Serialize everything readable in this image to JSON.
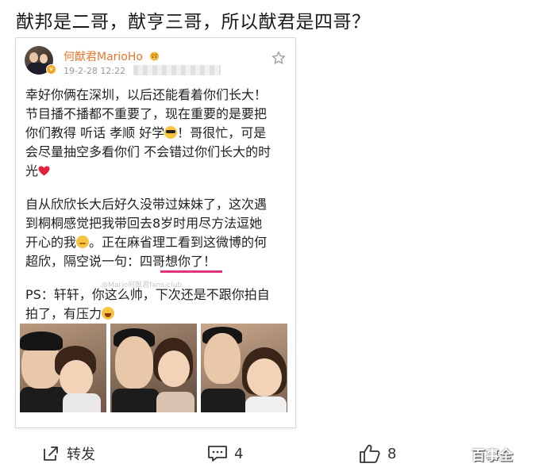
{
  "headline": "猷邦是二哥，猷亨三哥，所以猷君是四哥？",
  "post": {
    "author": "何猷君MarioHo",
    "timestamp": "19-2-28 12:22",
    "paragraphs": [
      [
        "幸好你俩在深圳，以后还能看着你们长大！",
        "节目播不播都不重要了，现在重要的是要把",
        "你们教得 听话 孝顺 好学",
        "会尽量抽空多看你们 不会错过你们长大的时",
        "光"
      ],
      [
        "自从欣欣长大后好久没带过妹妹了，这次遇",
        "到桐桐感觉把我带回去8岁时用尽方法逗她",
        "开心的我",
        "超欣，隔空说一句：四哥想你了！"
      ],
      [
        "PS：轩轩，你这么帅，下次还是不跟你拍自",
        "拍了，有压力"
      ]
    ],
    "line3_suffix": "！哥很忙，可是",
    "line8_suffix": "。正在麻省理工看到这微博的何",
    "watermark": "@Mario何猷君fans-club"
  },
  "actions": {
    "repost_label": "转发",
    "comment_count": "4",
    "like_count": "8"
  },
  "brand_watermark": "百事全",
  "icons": [
    "crown-icon",
    "verified-badge-icon",
    "star-icon",
    "heart-icon",
    "sunglasses-emoji-icon",
    "sweat-emoji-icon",
    "laugh-emoji-icon",
    "repost-icon",
    "comment-icon",
    "like-icon"
  ]
}
